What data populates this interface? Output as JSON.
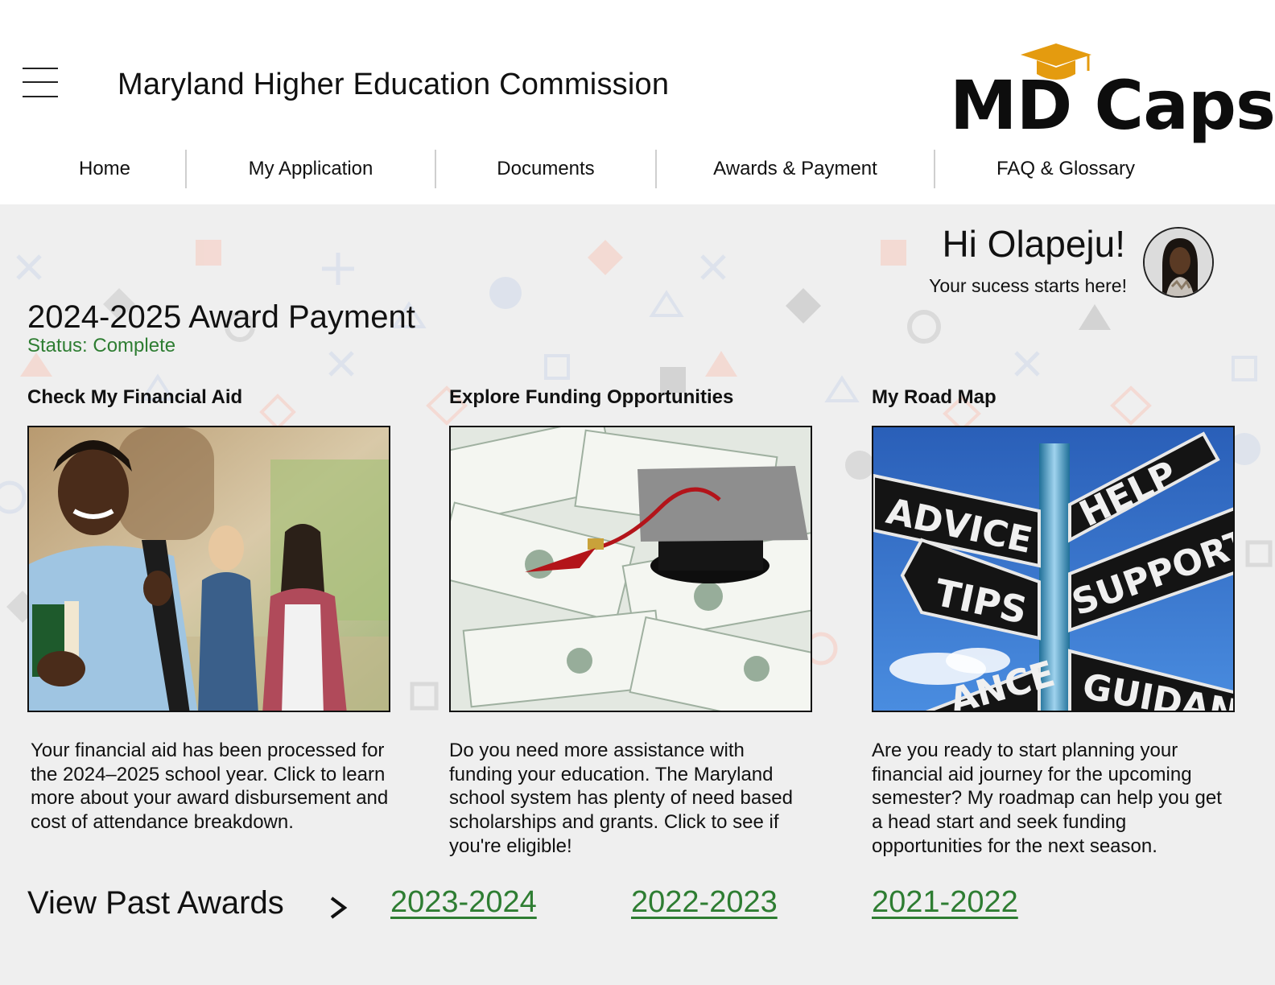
{
  "header": {
    "org_title": "Maryland Higher Education Commission",
    "logo_text": "MD Caps",
    "logo_color": "#e49b0f"
  },
  "nav": {
    "items": [
      {
        "label": "Home"
      },
      {
        "label": "My Application"
      },
      {
        "label": "Documents"
      },
      {
        "label": "Awards & Payment"
      },
      {
        "label": "FAQ & Glossary"
      }
    ]
  },
  "greeting": {
    "title": "Hi Olapeju!",
    "subtitle": "Your sucess starts here!"
  },
  "award": {
    "title": "2024-2025 Award Payment",
    "status": "Status: Complete",
    "status_color": "#2e7d32"
  },
  "cards": [
    {
      "heading": "Check My Financial Aid",
      "image_icon": "student-photo",
      "text": "Your financial aid has been processed for the 2024–2025 school year. Click to learn more about your award disbursement and cost of attendance breakdown."
    },
    {
      "heading": "Explore Funding Opportunities",
      "image_icon": "graduation-cap-money-photo",
      "text": "Do you need more assistance with funding your education. The Maryland school system has plenty of need based scholarships and grants. Click to see if you're eligible!"
    },
    {
      "heading": "My Road Map",
      "image_icon": "signpost-photo",
      "text": "Are you ready to start planning your financial aid journey for the upcoming semester? My roadmap can help you get a head start and seek funding opportunities for the next season.",
      "signs": [
        "ADVICE",
        "HELP",
        "TIPS",
        "SUPPORT",
        "ANCE",
        "GUIDAN"
      ]
    }
  ],
  "past_awards": {
    "label": "View Past Awards",
    "years": [
      "2023-2024",
      "2022-2023",
      "2021-2022"
    ]
  }
}
